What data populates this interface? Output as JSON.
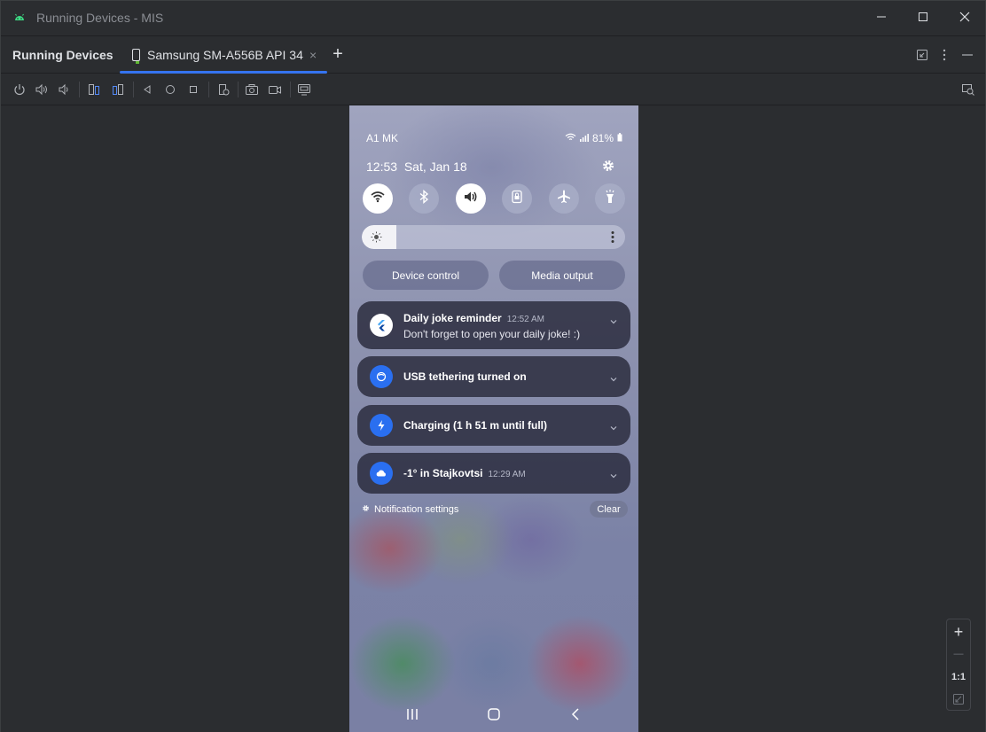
{
  "window": {
    "title": "Running Devices - MIS",
    "minimize_icon": "minimize-icon",
    "maximize_icon": "maximize-icon",
    "close_icon": "close-icon"
  },
  "tabbar": {
    "panel_title": "Running Devices",
    "tabs": [
      {
        "label": "Samsung SM-A556B API 34",
        "close": "×",
        "active": true
      }
    ],
    "add_tab": "+",
    "accent": "#3574f0"
  },
  "toolbar": {
    "icons": [
      "power-icon",
      "volume-up-icon",
      "volume-down-icon",
      "rotate-left-icon",
      "rotate-right-icon",
      "back-icon",
      "home-icon",
      "overview-icon",
      "snapshot-icon",
      "screenshot-icon",
      "screen-record-icon",
      "device-mirror-icon"
    ],
    "right_icon": "device-explorer-icon"
  },
  "phone": {
    "carrier": "A1 MK",
    "battery": "81%",
    "time": "12:53",
    "date": "Sat, Jan 18",
    "quick_settings": [
      {
        "name": "wifi",
        "on": true
      },
      {
        "name": "bluetooth",
        "on": false
      },
      {
        "name": "sound",
        "on": true
      },
      {
        "name": "screen-lock",
        "on": false
      },
      {
        "name": "airplane",
        "on": false
      },
      {
        "name": "flashlight",
        "on": false
      }
    ],
    "brightness_level": 0.13,
    "device_control": "Device control",
    "media_output": "Media output",
    "notifications": [
      {
        "title": "Daily joke reminder",
        "time": "12:52 AM",
        "body": "Don't forget to open your daily joke! :)",
        "icon": "flutter-icon"
      },
      {
        "title": "USB tethering turned on",
        "time": "",
        "body": "",
        "icon": "usb-tether-icon"
      },
      {
        "title": "Charging (1 h 51 m until full)",
        "time": "",
        "body": "",
        "icon": "charging-icon"
      },
      {
        "title": "-1° in Stajkovtsi",
        "time": "12:29 AM",
        "body": "",
        "icon": "weather-icon"
      }
    ],
    "notification_settings": "Notification settings",
    "clear": "Clear"
  },
  "zoom": {
    "zoom_in": "+",
    "zoom_out": "—",
    "actual_size": "1:1"
  }
}
